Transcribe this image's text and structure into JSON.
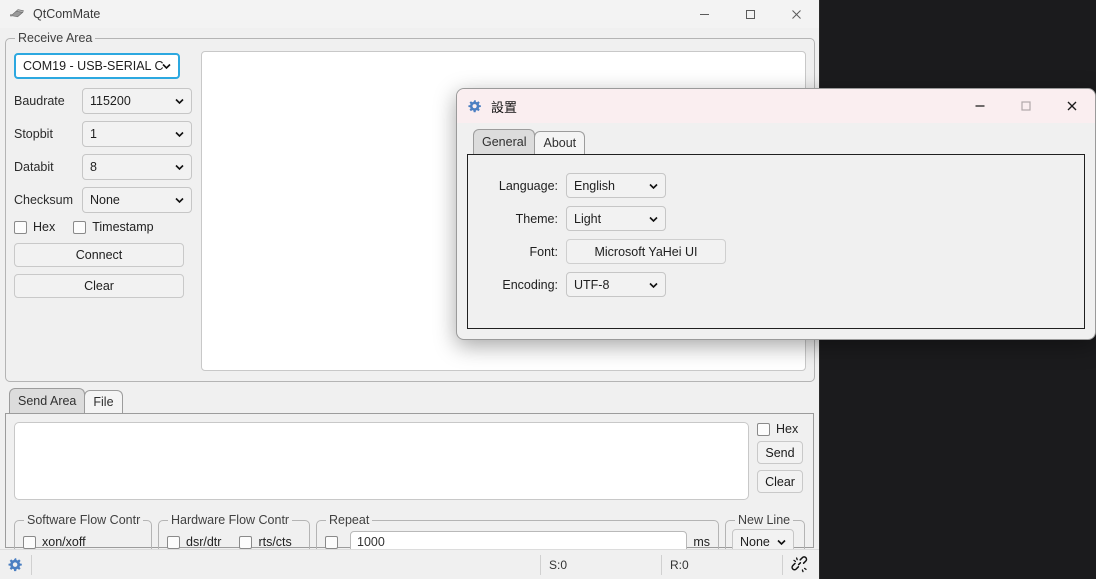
{
  "desktop": {
    "background": "#1b1b1d"
  },
  "main_window": {
    "title": "QtComMate",
    "icon": "serial-plug-icon",
    "titlebar_buttons": {
      "minimize": "─",
      "maximize": "□",
      "close": "✕"
    },
    "receive_group": {
      "title": "Receive Area",
      "port": {
        "value": "COM19 - USB-SERIAL C",
        "focused": true
      },
      "fields": [
        {
          "label": "Baudrate",
          "value": "115200"
        },
        {
          "label": "Stopbit",
          "value": "1"
        },
        {
          "label": "Databit",
          "value": "8"
        },
        {
          "label": "Checksum",
          "value": "None"
        }
      ],
      "checkboxes": [
        {
          "label": "Hex",
          "checked": false
        },
        {
          "label": "Timestamp",
          "checked": false
        }
      ],
      "buttons": {
        "connect": "Connect",
        "clear": "Clear"
      },
      "receive_text": ""
    },
    "send_section": {
      "tabs": [
        {
          "label": "Send Area",
          "selected": true
        },
        {
          "label": "File",
          "selected": false
        }
      ],
      "send_text": "",
      "hex_checkbox": {
        "label": "Hex",
        "checked": false
      },
      "buttons": {
        "send": "Send",
        "clear": "Clear"
      },
      "software_flow": {
        "title": "Software Flow Contr",
        "options": [
          {
            "label": "xon/xoff",
            "checked": false
          }
        ]
      },
      "hardware_flow": {
        "title": "Hardware Flow Contr",
        "options": [
          {
            "label": "dsr/dtr",
            "checked": false
          },
          {
            "label": "rts/cts",
            "checked": false
          }
        ]
      },
      "repeat": {
        "title": "Repeat",
        "enabled": false,
        "value": "1000",
        "unit": "ms"
      },
      "new_line": {
        "title": "New Line",
        "value": "None"
      }
    },
    "statusbar": {
      "settings_icon": "gear-icon",
      "sent": "S:0",
      "received": "R:0",
      "connection_icon": "disconnected-link-icon"
    }
  },
  "settings_dialog": {
    "title": "設置",
    "icon": "gear-icon",
    "titlebar_buttons": {
      "minimize": "─",
      "maximize": "□",
      "close": "✕"
    },
    "titlebar_color": "#faeef0",
    "tabs": [
      {
        "label": "General",
        "selected": true
      },
      {
        "label": "About",
        "selected": false
      }
    ],
    "general": {
      "language": {
        "label": "Language:",
        "value": "English"
      },
      "theme": {
        "label": "Theme:",
        "value": "Light"
      },
      "font": {
        "label": "Font:",
        "value": "Microsoft YaHei UI"
      },
      "encoding": {
        "label": "Encoding:",
        "value": "UTF-8"
      }
    }
  }
}
